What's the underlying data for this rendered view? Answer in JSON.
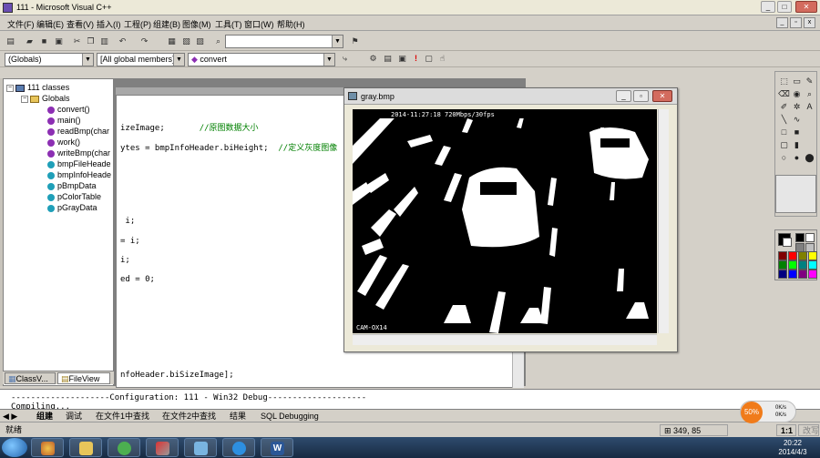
{
  "window": {
    "title": "111 - Microsoft Visual C++"
  },
  "menu": [
    "文件(F)",
    "编辑(E)",
    "查看(V)",
    "插入(I)",
    "工程(P)",
    "组建(B)",
    "图像(M)",
    "工具(T)",
    "窗口(W)",
    "帮助(H)"
  ],
  "wizard_bar": {
    "scope": "(Globals)",
    "filter": "[All global members]",
    "member": "convert"
  },
  "workspace": {
    "root": "111 classes",
    "folder": "Globals",
    "items": [
      {
        "label": "convert()",
        "kind": "func"
      },
      {
        "label": "main()",
        "kind": "func"
      },
      {
        "label": "readBmp(char",
        "kind": "func"
      },
      {
        "label": "work()",
        "kind": "func"
      },
      {
        "label": "writeBmp(char",
        "kind": "func"
      },
      {
        "label": "bmpFileHeade",
        "kind": "var"
      },
      {
        "label": "bmpInfoHeade",
        "kind": "var"
      },
      {
        "label": "pBmpData",
        "kind": "var"
      },
      {
        "label": "pColorTable",
        "kind": "var"
      },
      {
        "label": "pGrayData",
        "kind": "var"
      }
    ],
    "tabs": [
      "ClassV...",
      "FileView"
    ]
  },
  "editor": {
    "lines": [
      {
        "code": "izeImage;       ",
        "comment": "//原图数据大小"
      },
      {
        "code": "ytes = bmpInfoHeader.biHeight;  ",
        "comment": "//定义灰度图像"
      },
      {
        "code": " i;",
        "comment": ""
      },
      {
        "code": "= i;",
        "comment": ""
      },
      {
        "code": "i;",
        "comment": ""
      },
      {
        "code": "ed = 0;",
        "comment": ""
      },
      {
        "code": "nfoHeader.biSizeImage];",
        "comment": ""
      }
    ]
  },
  "image_window": {
    "title": "gray.bmp",
    "overlay_timestamp": "2014-11:27:18 720Mbps/30fps",
    "overlay_camera": "CAM-OX14"
  },
  "output": {
    "configuration_line": "--------------------Configuration: 111 - Win32 Debug--------------------",
    "compiling_line": "Compiling...",
    "tabs": [
      "组建",
      "调试",
      "在文件1中查找",
      "在文件2中查找",
      "结果",
      "SQL Debugging"
    ]
  },
  "status": {
    "left": "就绪",
    "position": "349, 85",
    "zoom": "1:1",
    "mode": "改写"
  },
  "speed_widget": {
    "percent": "50%",
    "up": "0K/s",
    "down": "0K/s"
  },
  "clock": {
    "time": "20:22",
    "date": "2014/4/3"
  },
  "colors": {
    "palette": [
      "#000000",
      "#ffffff",
      "#808080",
      "#c0c0c0",
      "#800000",
      "#ff0000",
      "#808000",
      "#ffff00",
      "#008000",
      "#00ff00",
      "#008080",
      "#00ffff",
      "#000080",
      "#0000ff",
      "#800080",
      "#ff00ff"
    ]
  }
}
